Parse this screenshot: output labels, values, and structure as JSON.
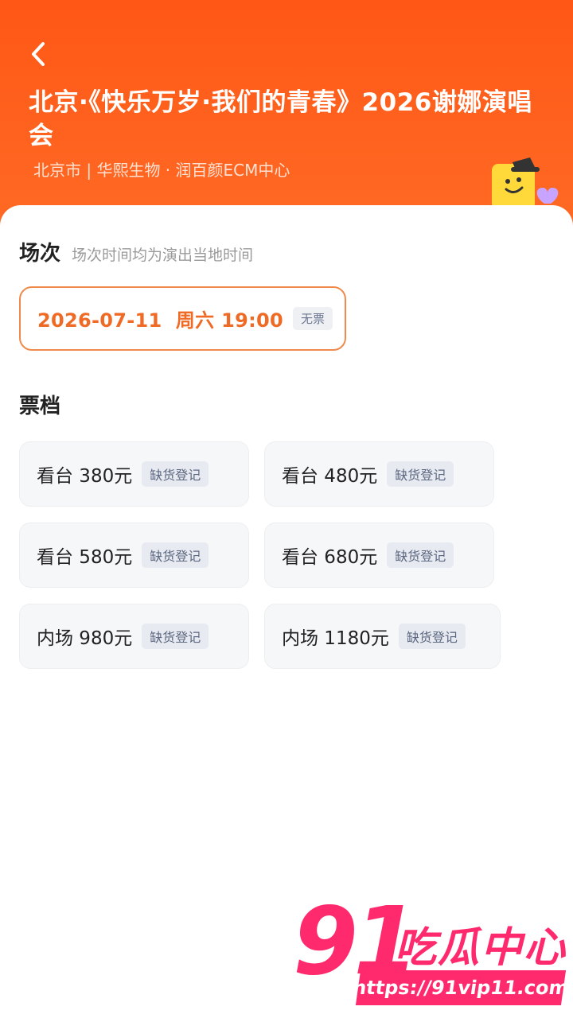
{
  "header": {
    "back_icon": "chevron-left-icon",
    "title": "北京·《快乐万岁·我们的青春》2026谢娜演唱会",
    "subtitle": "北京市 | 华熙生物 · 润百颜ECM中心",
    "mascot_icon": "yellow-smiley-mascot-icon"
  },
  "session": {
    "title": "场次",
    "note": "场次时间均为演出当地时间",
    "options": [
      {
        "date": "2026-07-11  周六 19:00",
        "badge": "无票"
      }
    ]
  },
  "tiers": {
    "title": "票档",
    "items": [
      {
        "label": "看台 380元",
        "badge": "缺货登记"
      },
      {
        "label": "看台 480元",
        "badge": "缺货登记"
      },
      {
        "label": "看台 580元",
        "badge": "缺货登记"
      },
      {
        "label": "看台 680元",
        "badge": "缺货登记"
      },
      {
        "label": "内场 980元",
        "badge": "缺货登记"
      },
      {
        "label": "内场 1180元",
        "badge": "缺货登记"
      }
    ]
  },
  "watermark": {
    "number": "91",
    "text": "吃瓜中心",
    "url": "https://91vip11.com"
  },
  "colors": {
    "brand_orange": "#ff5a1f",
    "accent_text": "#ef6a25",
    "watermark_pink": "#ff2a6d"
  }
}
